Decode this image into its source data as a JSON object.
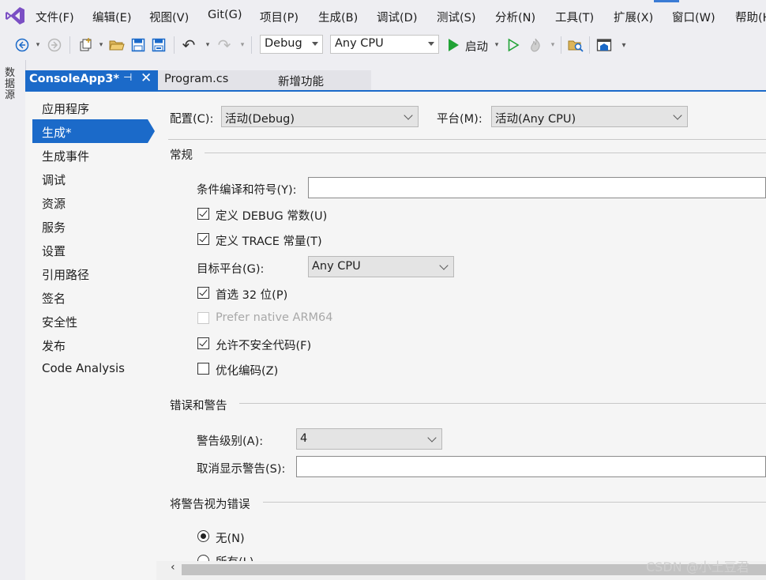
{
  "menu": [
    "文件(F)",
    "编辑(E)",
    "视图(V)",
    "Git(G)",
    "项目(P)",
    "生成(B)",
    "调试(D)",
    "测试(S)",
    "分析(N)",
    "工具(T)",
    "扩展(X)",
    "窗口(W)",
    "帮助(H)"
  ],
  "toolbar": {
    "config_value": "Debug",
    "platform_value": "Any CPU",
    "start_label": "启动"
  },
  "side_panel_label": "数据源",
  "tabs": {
    "active": "ConsoleApp3*",
    "program": "Program.cs",
    "new_feature": "新增功能"
  },
  "nav": [
    "应用程序",
    "生成*",
    "生成事件",
    "调试",
    "资源",
    "服务",
    "设置",
    "引用路径",
    "签名",
    "安全性",
    "发布",
    "Code Analysis"
  ],
  "config": {
    "config_label": "配置(C):",
    "config_value": "活动(Debug)",
    "platform_label": "平台(M):",
    "platform_value": "活动(Any CPU)"
  },
  "general": {
    "title": "常规",
    "conditional_label": "条件编译和符号(Y):",
    "conditional_value": "",
    "define_debug": "定义 DEBUG 常数(U)",
    "define_trace": "定义 TRACE 常量(T)",
    "target_label": "目标平台(G):",
    "target_value": "Any CPU",
    "prefer32": "首选 32 位(P)",
    "prefer_arm64": "Prefer native ARM64",
    "unsafe": "允许不安全代码(F)",
    "optimize": "优化编码(Z)"
  },
  "errors": {
    "title": "错误和警告",
    "warning_level_label": "警告级别(A):",
    "warning_level_value": "4",
    "suppress_label": "取消显示警告(S):",
    "suppress_value": ""
  },
  "treat_as_errors": {
    "title": "将警告视为错误",
    "none": "无(N)",
    "all": "所有(L)"
  },
  "watermark": "CSDN @小土豆君"
}
